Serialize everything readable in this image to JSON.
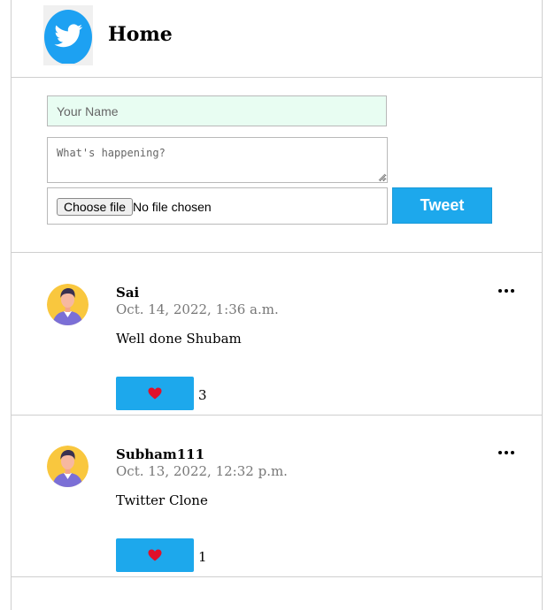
{
  "header": {
    "title": "Home",
    "logo_icon": "twitter-bird-icon",
    "brand_color": "#1DA1F2"
  },
  "compose": {
    "name_placeholder": "Your Name",
    "text_placeholder": "What's happening?",
    "file_button_label": "Choose file",
    "file_status": "No file chosen",
    "tweet_button_label": "Tweet"
  },
  "posts": [
    {
      "author": "Sai",
      "timestamp": "Oct. 14, 2022, 1:36 a.m.",
      "text": "Well done Shubam",
      "likes": "3"
    },
    {
      "author": "Subham111",
      "timestamp": "Oct. 13, 2022, 12:32 p.m.",
      "text": "Twitter Clone",
      "likes": "1"
    }
  ],
  "colors": {
    "accent": "#1DA8EC",
    "heart": "#E0102A",
    "name_input_bg": "#E8FDF2"
  }
}
